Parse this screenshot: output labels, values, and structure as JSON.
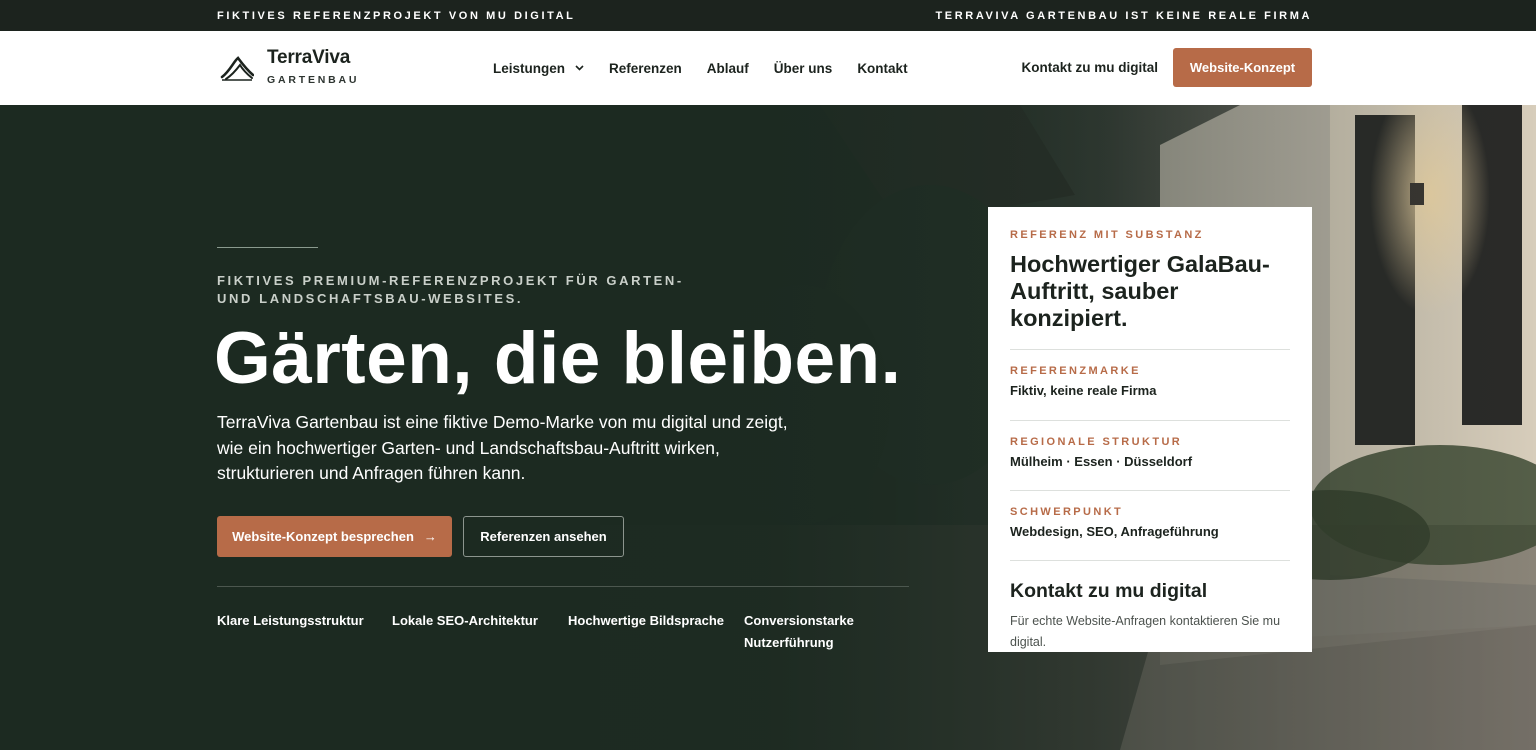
{
  "topbar": {
    "left": "Fiktives Referenzprojekt von mu digital",
    "right": "TerraViva Gartenbau ist keine reale Firma"
  },
  "header": {
    "logo_name": "TerraViva",
    "logo_sub": "GARTENBAU",
    "nav": [
      {
        "label": "Leistungen"
      },
      {
        "label": "Referenzen"
      },
      {
        "label": "Ablauf"
      },
      {
        "label": "Über uns"
      },
      {
        "label": "Kontakt"
      }
    ],
    "contact_link": "Kontakt zu mu digital",
    "cta_label": "Website-Konzept"
  },
  "hero": {
    "kicker": "Fiktives Premium-Referenzprojekt für Garten- und Landschaftsbau-Websites.",
    "headline": "Gärten, die bleiben.",
    "lead": "TerraViva Gartenbau ist eine fiktive Demo-Marke von mu digital und zeigt, wie ein hochwertiger Garten- und Landschaftsbau-Auftritt wirken, strukturieren und Anfragen führen kann.",
    "cta_primary": "Website-Konzept besprechen",
    "cta_primary_arrow": "→",
    "cta_secondary": "Referenzen ansehen",
    "features": [
      "Klare Leistungsstruktur",
      "Lokale SEO-Architektur",
      "Hochwertige Bildsprache",
      "Conversionstarke Nutzerführung"
    ]
  },
  "card": {
    "kicker": "Referenz mit Substanz",
    "title": "Hochwertiger GalaBau-Auftritt, sauber konzipiert.",
    "rows": [
      {
        "label": "Referenzmarke",
        "value": "Fiktiv, keine reale Firma"
      },
      {
        "label": "Regionale Struktur",
        "value": "Mülheim · Essen · Düsseldorf"
      },
      {
        "label": "Schwerpunkt",
        "value": "Webdesign, SEO, Anfrageführung"
      }
    ],
    "contact_title": "Kontakt zu mu digital",
    "contact_text": "Für echte Website-Anfragen kontaktieren Sie mu digital."
  },
  "colors": {
    "accent": "#b76b48",
    "dark": "#1c231e",
    "hero_bg": "#1f2a22"
  },
  "icons": {
    "logo": "terraviva-mountain-logo-icon",
    "nav_dropdown": "chevron-down-icon",
    "cta_arrow": "arrow-right-icon"
  }
}
